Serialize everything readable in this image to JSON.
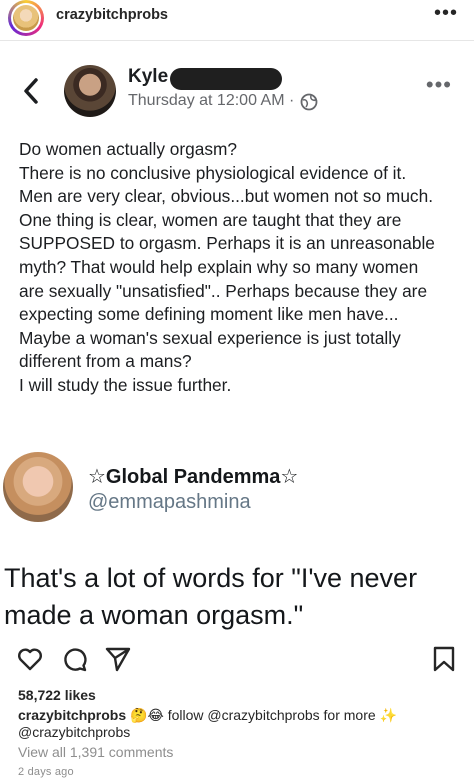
{
  "header": {
    "username": "crazybitchprobs",
    "more_icon": "more-horizontal-icon"
  },
  "facebook_post": {
    "back_icon": "back-chevron-icon",
    "author_name": "Kyle",
    "timestamp": "Thursday at 12:00 AM ·",
    "privacy_icon": "globe-icon",
    "more_label": "•••",
    "lines": [
      "Do women actually orgasm?",
      "There is no conclusive physiological evidence of it.",
      "Men are very clear, obvious...but women not so much.",
      "One thing is clear, women are taught that they are",
      "SUPPOSED to orgasm.  Perhaps it is an unreasonable",
      "myth?  That would help explain why so many women",
      "are sexually \"unsatisfied\".. Perhaps because they are",
      "expecting some defining moment like men have...",
      "Maybe a woman's sexual experience is just totally",
      "different from a mans?",
      "I will study the issue further."
    ]
  },
  "tweet": {
    "display_name": "☆Global Pandemma☆",
    "handle": "@emmapashmina",
    "lines": [
      "That's a lot of words for \"I've never",
      "made a woman orgasm.\""
    ]
  },
  "post_actions": {
    "like_icon": "heart-icon",
    "comment_icon": "comment-icon",
    "share_icon": "send-icon",
    "save_icon": "bookmark-icon"
  },
  "likes": "58,722 likes",
  "caption": {
    "username": "crazybitchprobs",
    "emojis": "🤔😂",
    "text": " follow @crazybitchprobs for more ✨",
    "line2": "@crazybitchprobs"
  },
  "view_comments": "View all 1,391 comments",
  "time_ago": "2 days ago"
}
